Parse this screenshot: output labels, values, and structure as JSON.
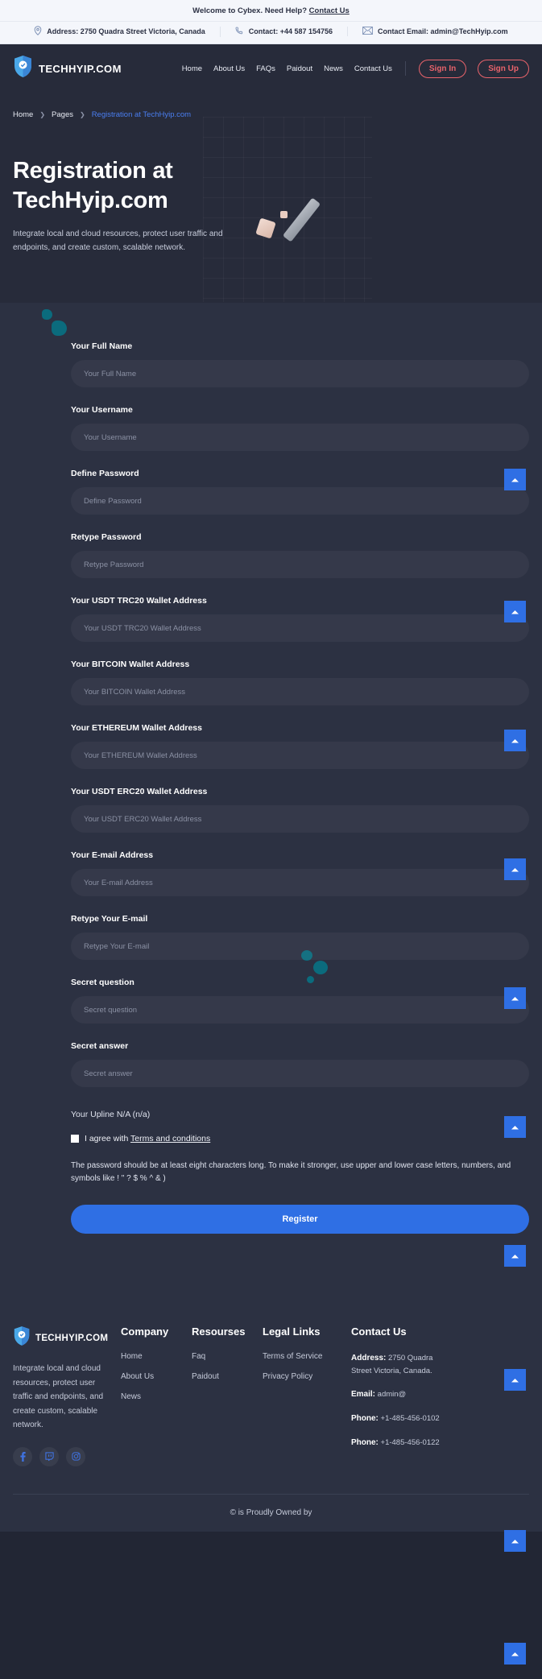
{
  "topbar": {
    "welcome_text": "Welcome to Cybex. Need Help?",
    "welcome_link": "Contact Us",
    "address": "Address: 2750 Quadra Street Victoria, Canada",
    "contact": "Contact: +44 587 154756",
    "email": "Contact Email: admin@TechHyip.com"
  },
  "header": {
    "brand": "TECHHYIP.COM",
    "nav": [
      {
        "label": "Home"
      },
      {
        "label": "About Us"
      },
      {
        "label": "FAQs"
      },
      {
        "label": "Paidout"
      },
      {
        "label": "News"
      },
      {
        "label": "Contact Us"
      }
    ],
    "signin_label": "Sign In",
    "signup_label": "Sign Up"
  },
  "hero": {
    "breadcrumb": [
      {
        "label": "Home"
      },
      {
        "label": "Pages"
      },
      {
        "label": "Registration at TechHyip.com"
      }
    ],
    "title": "Registration at TechHyip.com",
    "subtitle": "Integrate local and cloud resources, protect user traffic and endpoints, and create custom, scalable network."
  },
  "form": {
    "fields": [
      {
        "label": "Your Full Name",
        "placeholder": "Your Full Name",
        "value": ""
      },
      {
        "label": "Your Username",
        "placeholder": "Your Username",
        "value": ""
      },
      {
        "label": "Define Password",
        "placeholder": "Define Password",
        "value": ""
      },
      {
        "label": "Retype Password",
        "placeholder": "Retype Password",
        "value": ""
      },
      {
        "label": "Your USDT TRC20 Wallet Address",
        "placeholder": "Your USDT TRC20 Wallet Address",
        "value": ""
      },
      {
        "label": "Your BITCOIN Wallet Address",
        "placeholder": "Your BITCOIN Wallet Address",
        "value": ""
      },
      {
        "label": "Your ETHEREUM Wallet Address",
        "placeholder": "Your ETHEREUM Wallet Address",
        "value": ""
      },
      {
        "label": "Your USDT ERC20 Wallet Address",
        "placeholder": "Your USDT ERC20 Wallet Address",
        "value": ""
      },
      {
        "label": "Your E-mail Address",
        "placeholder": "Your E-mail Address",
        "value": ""
      },
      {
        "label": "Retype Your E-mail",
        "placeholder": "Retype Your E-mail",
        "value": ""
      },
      {
        "label": "Secret question",
        "placeholder": "Secret question",
        "value": ""
      },
      {
        "label": "Secret answer",
        "placeholder": "Secret answer",
        "value": ""
      }
    ],
    "upline": "Your Upline N/A (n/a)",
    "agree_prefix": "I agree with ",
    "agree_link": "Terms and conditions",
    "password_hint": "The password should be at least eight characters long. To make it stronger, use upper and lower case letters, numbers, and symbols like ! \" ? $ % ^ & )",
    "register_label": "Register"
  },
  "footer": {
    "brand": "TECHHYIP.COM",
    "about": "Integrate local and cloud resources, protect user traffic and endpoints, and create custom, scalable network.",
    "socials": [
      {
        "name": "facebook-icon"
      },
      {
        "name": "twitch-icon"
      },
      {
        "name": "instagram-icon"
      }
    ],
    "columns": [
      {
        "title": "Company",
        "links": [
          {
            "label": "Home"
          },
          {
            "label": "About Us"
          },
          {
            "label": "News"
          }
        ]
      },
      {
        "title": "Resourses",
        "links": [
          {
            "label": "Faq"
          },
          {
            "label": "Paidout"
          }
        ]
      },
      {
        "title": "Legal Links",
        "links": [
          {
            "label": "Terms of Service"
          },
          {
            "label": "Privacy Policy"
          }
        ]
      }
    ],
    "contact": {
      "title": "Contact Us",
      "address_label": "Address:",
      "address_value": " 2750 Quadra Street Victoria, Canada.",
      "email_label": "Email:",
      "email_value": " admin@",
      "phone1_label": "Phone:",
      "phone1_value": " +1-485-456-0102",
      "phone2_label": "Phone:",
      "phone2_value": " +1-485-456-0122"
    },
    "copyright": "© is Proudly Owned by"
  },
  "colors": {
    "accent_blue": "#2f6fe4",
    "accent_red": "#e8636b",
    "teal_blob": "#0b6b7d",
    "dark_bg": "#272b3a",
    "panel_bg": "#2c3142"
  },
  "scrolltop": {
    "icon": "chevron-up-icon"
  }
}
